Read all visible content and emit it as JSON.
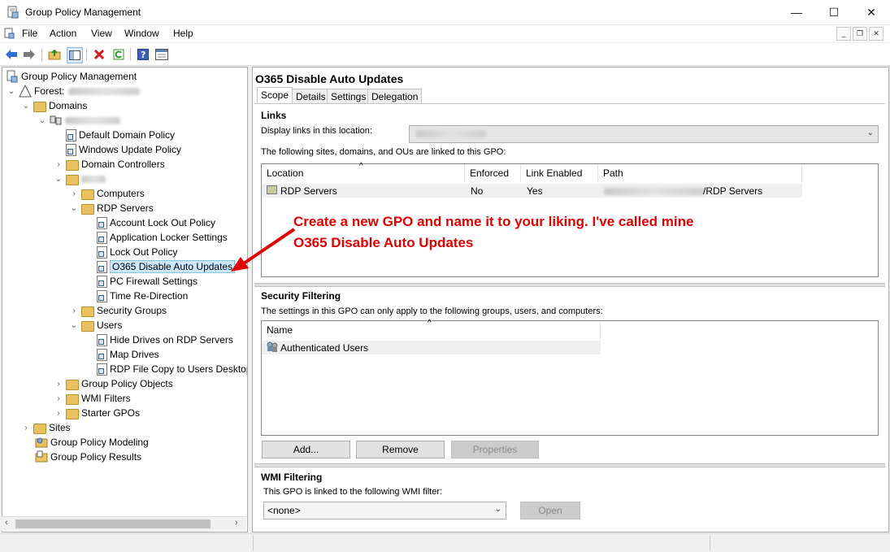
{
  "window": {
    "title": "Group Policy Management",
    "minimize_glyph": "—",
    "maximize_glyph": "☐",
    "close_glyph": "✕"
  },
  "menu": {
    "items": [
      "File",
      "Action",
      "View",
      "Window",
      "Help"
    ]
  },
  "toolbar": {
    "icons": [
      "back-arrow-icon",
      "forward-arrow-icon",
      "up-folder-icon",
      "show-hide-tree-icon",
      "delete-icon",
      "refresh-icon",
      "help-icon",
      "properties-icon"
    ]
  },
  "tree": {
    "root": "Group Policy Management",
    "forest_label": "Forest:",
    "domains": "Domains",
    "default_domain_policy": "Default Domain Policy",
    "windows_update_policy": "Windows Update Policy",
    "domain_controllers": "Domain Controllers",
    "computers": "Computers",
    "rdp_servers": "RDP Servers",
    "account_lockout": "Account Lock Out Policy",
    "app_locker": "Application Locker Settings",
    "lock_out": "Lock Out Policy",
    "o365": "O365 Disable Auto Updates",
    "pc_firewall": "PC Firewall Settings",
    "time_redirection": "Time Re-Direction",
    "security_groups": "Security Groups",
    "users": "Users",
    "hide_drives": "Hide Drives on RDP Servers",
    "map_drives": "Map Drives",
    "rdp_file_copy": "RDP File Copy to Users Desktop",
    "gpo_objects": "Group Policy Objects",
    "wmi_filters": "WMI Filters",
    "starter_gpos": "Starter GPOs",
    "sites": "Sites",
    "modeling": "Group Policy Modeling",
    "results": "Group Policy Results"
  },
  "details": {
    "title": "O365 Disable Auto Updates",
    "tabs": [
      "Scope",
      "Details",
      "Settings",
      "Delegation"
    ],
    "links": {
      "section": "Links",
      "display_label": "Display links in this location:",
      "description": "The following sites, domains, and OUs are linked to this GPO:",
      "columns": [
        "Location",
        "Enforced",
        "Link Enabled",
        "Path"
      ],
      "rows": [
        {
          "location": "RDP Servers",
          "enforced": "No",
          "link_enabled": "Yes",
          "path_suffix": "/RDP Servers"
        }
      ]
    },
    "security": {
      "section": "Security Filtering",
      "description": "The settings in this GPO can only apply to the following groups, users, and computers:",
      "column": "Name",
      "rows": [
        "Authenticated Users"
      ],
      "add": "Add...",
      "remove": "Remove",
      "properties": "Properties"
    },
    "wmi": {
      "section": "WMI Filtering",
      "description": "This GPO is linked to the following WMI filter:",
      "value": "<none>",
      "open": "Open"
    }
  },
  "annotation": {
    "line1": "Create a new GPO and name it to your liking. I've called mine",
    "line2": "O365 Disable Auto Updates",
    "color": "#e00000"
  }
}
